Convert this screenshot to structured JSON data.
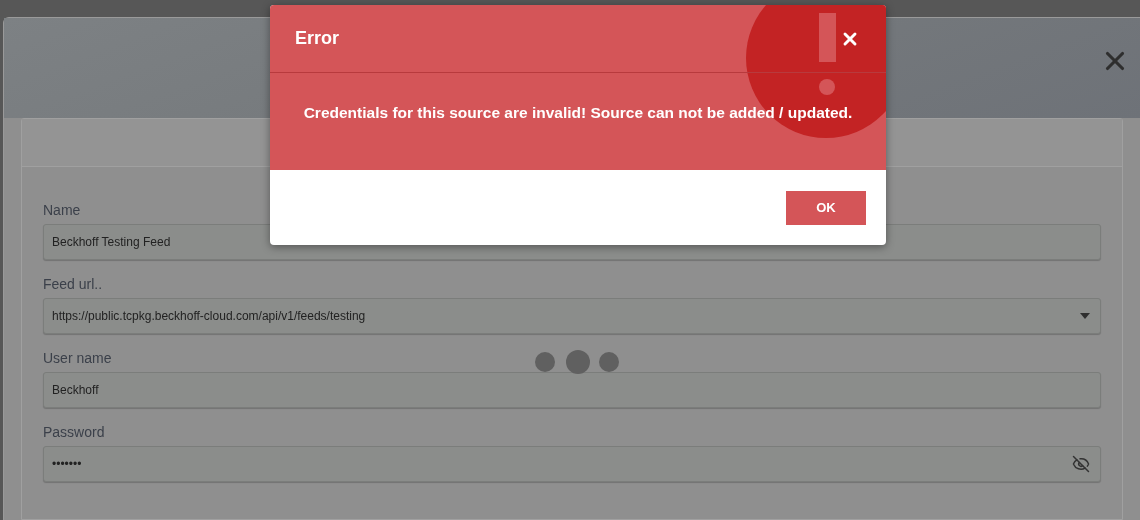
{
  "form": {
    "fields": [
      {
        "kind": "text",
        "label": "Name",
        "value": "Beckhoff Testing Feed"
      },
      {
        "kind": "select",
        "label": "Feed url..",
        "value": "https://public.tcpkg.beckhoff-cloud.com/api/v1/feeds/testing"
      },
      {
        "kind": "text",
        "label": "User name",
        "value": "Beckhoff"
      },
      {
        "kind": "password",
        "label": "Password",
        "value": "•••••••"
      }
    ]
  },
  "loading": true,
  "error_dialog": {
    "title": "Error",
    "message": "Credentials for this source are invalid! Source can not be added / updated.",
    "ok_button": "OK"
  }
}
